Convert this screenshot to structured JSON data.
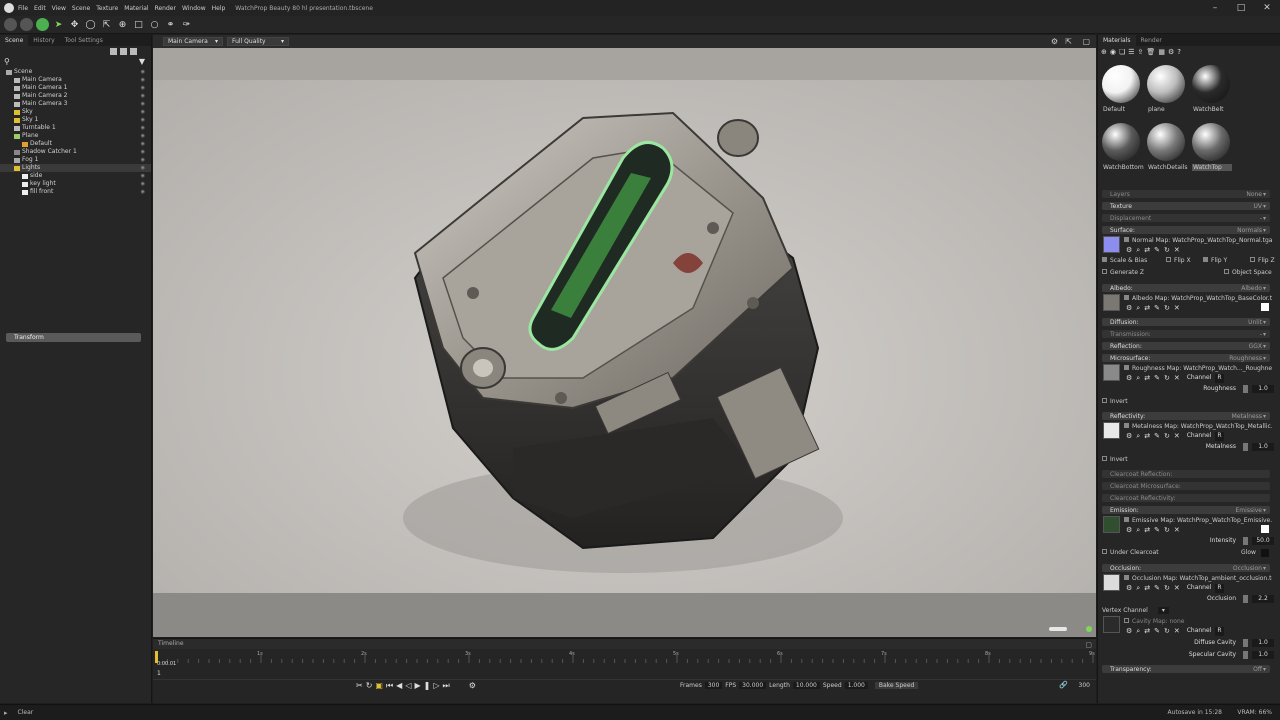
{
  "title_bar": {
    "menus": [
      "File",
      "Edit",
      "View",
      "Scene",
      "Texture",
      "Material",
      "Render",
      "Window",
      "Help"
    ],
    "document": "WatchProp Beauty 80 hl presentation.tbscene"
  },
  "left": {
    "tabs": [
      "Scene",
      "History",
      "Tool Settings"
    ],
    "tree": [
      {
        "label": "Scene",
        "depth": 0,
        "icon": "scene-icon"
      },
      {
        "label": "Main Camera",
        "depth": 1,
        "icon": "camera-icon"
      },
      {
        "label": "Main Camera 1",
        "depth": 1,
        "icon": "camera-icon"
      },
      {
        "label": "Main Camera 2",
        "depth": 1,
        "icon": "camera-icon"
      },
      {
        "label": "Main Camera 3",
        "depth": 1,
        "icon": "camera-icon"
      },
      {
        "label": "Sky",
        "depth": 1,
        "icon": "sky-icon"
      },
      {
        "label": "Sky 1",
        "depth": 1,
        "icon": "sky-icon"
      },
      {
        "label": "Turntable 1",
        "depth": 1,
        "icon": "turntable-icon"
      },
      {
        "label": "Plane",
        "depth": 1,
        "icon": "mesh-icon"
      },
      {
        "label": "Default",
        "depth": 2,
        "icon": "material-icon"
      },
      {
        "label": "Shadow Catcher 1",
        "depth": 1,
        "icon": "shadow-icon"
      },
      {
        "label": "Fog 1",
        "depth": 1,
        "icon": "fog-icon"
      },
      {
        "label": "Lights",
        "depth": 1,
        "icon": "folder-icon",
        "selected": true
      },
      {
        "label": "side",
        "depth": 2,
        "icon": "light-icon"
      },
      {
        "label": "key light",
        "depth": 2,
        "icon": "light-icon"
      },
      {
        "label": "fill front",
        "depth": 2,
        "icon": "light-icon"
      }
    ],
    "transform": "Transform"
  },
  "viewport": {
    "camera": "Main Camera",
    "quality": "Full Quality"
  },
  "timeline": {
    "label": "Timeline",
    "current": "0:00.01",
    "frame": "1",
    "ticks": [
      "1s",
      "2s",
      "3s",
      "4s",
      "5s",
      "6s",
      "7s",
      "8s",
      "9s"
    ],
    "frames_label": "Frames",
    "frames": "300",
    "fps_label": "FPS",
    "fps": "30.000",
    "length_label": "Length",
    "length": "10.000",
    "speed_label": "Speed",
    "speed": "1.000",
    "bake": "Bake Speed",
    "end": "300"
  },
  "right": {
    "tabs": [
      "Materials",
      "Render"
    ],
    "materials": [
      {
        "name": "Default",
        "color": "#f2f2f2"
      },
      {
        "name": "plane",
        "color": "#bdbdbd"
      },
      {
        "name": "WatchBelt",
        "color": "#2a2a2a"
      },
      {
        "name": "WatchBottom",
        "color": "#5b5b5b"
      },
      {
        "name": "WatchDetails",
        "color": "#7a7a7a"
      },
      {
        "name": "WatchTop",
        "color": "#6b6b6b"
      }
    ],
    "layers": "Layers",
    "layers_v": "None",
    "texture": "Texture",
    "texture_v": "UV",
    "displacement": "Displacement",
    "displacement_v": "-",
    "surface": "Surface:",
    "surface_v": "Normals",
    "normal_map": "Normal Map: WatchProp_WatchTop_Normal.tga",
    "scale_bias": "Scale & Bias",
    "flip_x": "Flip X",
    "flip_y": "Flip Y",
    "flip_z": "Flip Z",
    "generate_z": "Generate Z",
    "object_space": "Object Space",
    "albedo": "Albedo:",
    "albedo_v": "Albedo",
    "albedo_map": "Albedo Map: WatchProp_WatchTop_BaseColor.tga",
    "diffusion": "Diffusion:",
    "diffusion_v": "Unlit",
    "transmission": "Transmission:",
    "transmission_v": "-",
    "reflection": "Reflection:",
    "reflection_v": "GGX",
    "microsurface": "Microsurface:",
    "microsurface_v": "Roughness",
    "roughness_map": "Roughness Map: WatchProp_Watch..._Roughness.tga",
    "channel": "Channel",
    "channel_v": "R",
    "roughness": "Roughness",
    "roughness_val": "1.0",
    "invert": "Invert",
    "reflectivity": "Reflectivity:",
    "reflectivity_v": "Metalness",
    "metalness_map": "Metalness Map: WatchProp_WatchTop_Metallic.tga",
    "metalness": "Metalness",
    "metalness_val": "1.0",
    "cc_reflection": "Clearcoat Reflection:",
    "cc_micro": "Clearcoat Microsurface:",
    "cc_reflectivity": "Clearcoat Reflectivity:",
    "emission": "Emission:",
    "emission_v": "Emissive",
    "emissive_map": "Emissive Map: WatchProp_WatchTop_Emissive.tga",
    "intensity": "Intensity",
    "intensity_val": "50.0",
    "under_clearcoat": "Under Clearcoat",
    "glow": "Glow",
    "occlusion": "Occlusion:",
    "occlusion_v": "Occlusion",
    "occlusion_map": "Occlusion Map: WatchTop_ambient_occlusion.tga",
    "occlusion_lbl": "Occlusion",
    "occlusion_val": "2.2",
    "vertex_channel": "Vertex Channel",
    "cavity_map": "Cavity Map: none",
    "diffuse_cavity": "Diffuse Cavity",
    "diffuse_cavity_val": "1.0",
    "specular_cavity": "Specular Cavity",
    "specular_cavity_val": "1.0",
    "transparency": "Transparency:",
    "transparency_v": "Off"
  },
  "status": {
    "clear": "Clear",
    "autosave": "Autosave in 15:28",
    "vram": "VRAM: 66%"
  }
}
